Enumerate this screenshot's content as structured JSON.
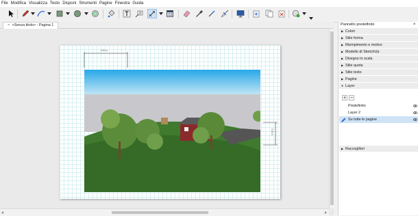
{
  "menu": {
    "items": [
      "File",
      "Modifica",
      "Visualizza",
      "Testo",
      "Disponi",
      "Strumenti",
      "Pagine",
      "Finestra",
      "Guida"
    ]
  },
  "toolbar": {
    "tools": [
      "select-arrow-icon",
      "pencil-icon",
      "line-tool-icon",
      "shape-square-icon",
      "circle-icon",
      "offset-icon",
      "paint-bucket-icon",
      "text-icon",
      "label-icon",
      "dimension-icon",
      "table-icon",
      "eraser-icon",
      "eyedropper-icon",
      "style-icon",
      "split-icon",
      "present-icon",
      "add-page-icon",
      "duplicate-page-icon",
      "delete-page-icon",
      "send-to-sketchup-icon"
    ],
    "active_tool": "dimension-icon"
  },
  "document": {
    "tab_label": "<Senza titolo> - Pagina 1",
    "tab_close": "×",
    "dimension_top": "0.00 m",
    "dimension_right": "0.00 m"
  },
  "tray": {
    "title": "Pannello predefinito",
    "close": "×",
    "panels": [
      "Colori",
      "Stile forma",
      "Riempimento e motivo",
      "Modello di SketchUp",
      "Disegno in scala",
      "Stile quota",
      "Stile testo",
      "Pagine",
      "Layer"
    ],
    "layer_add": "+",
    "layer_remove": "−",
    "layers": [
      {
        "name": "Predefinito"
      },
      {
        "name": "Layer 2"
      },
      {
        "name": "Su tutte le pagine",
        "selected": true
      }
    ],
    "collections_label": "Raccoglitori"
  },
  "colors": {
    "sky_top": "#28a8e8",
    "grass": "#3f7a2e",
    "house_roof": "#5a5a5a",
    "house_wall": "#8a2a2a",
    "grid_line": "#d7efef",
    "selection": "#cfe3f7"
  }
}
